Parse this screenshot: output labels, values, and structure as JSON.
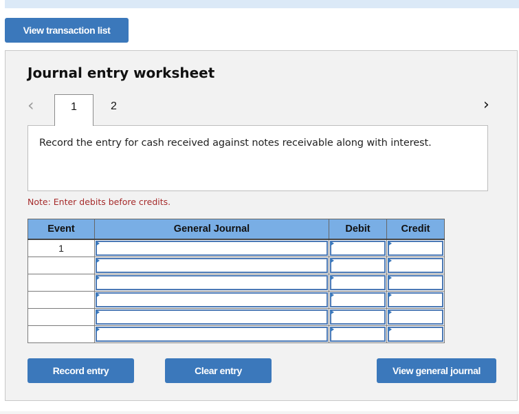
{
  "top_button": {
    "label": "View transaction list"
  },
  "worksheet": {
    "title": "Journal entry worksheet",
    "tabs": [
      {
        "label": "1",
        "active": true
      },
      {
        "label": "2",
        "active": false
      }
    ],
    "nav": {
      "prev_icon": "chevron-left-icon",
      "next_icon": "chevron-right-icon",
      "prev_glyph": "‹",
      "next_glyph": "›"
    },
    "description": "Record the entry for cash received against notes receivable along with interest.",
    "note": "Note: Enter debits before credits.",
    "table": {
      "headers": [
        "Event",
        "General Journal",
        "Debit",
        "Credit"
      ],
      "rows": [
        {
          "event": "1",
          "account": "",
          "debit": "",
          "credit": ""
        },
        {
          "event": "",
          "account": "",
          "debit": "",
          "credit": ""
        },
        {
          "event": "",
          "account": "",
          "debit": "",
          "credit": ""
        },
        {
          "event": "",
          "account": "",
          "debit": "",
          "credit": ""
        },
        {
          "event": "",
          "account": "",
          "debit": "",
          "credit": ""
        },
        {
          "event": "",
          "account": "",
          "debit": "",
          "credit": ""
        }
      ]
    },
    "buttons": {
      "record": "Record entry",
      "clear": "Clear entry",
      "view_general_journal": "View general journal"
    }
  },
  "colors": {
    "button_blue": "#3b78bb",
    "header_blue": "#79aee5",
    "note_red": "#a52a2a",
    "panel_bg": "#f2f2f2"
  }
}
